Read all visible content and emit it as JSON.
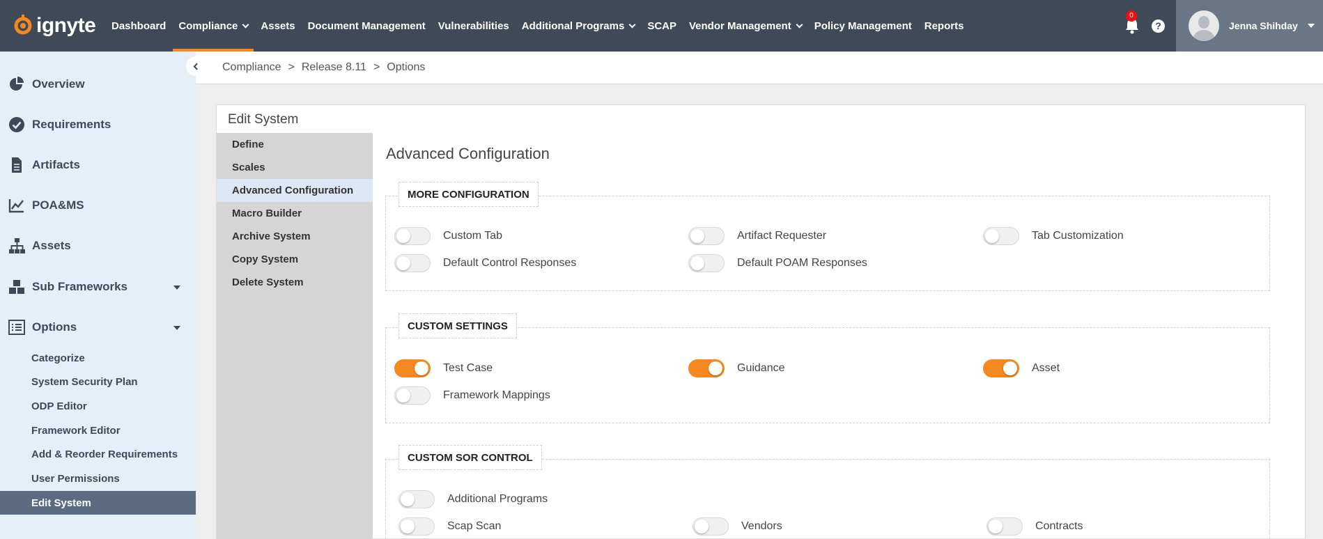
{
  "brand": {
    "name": "ignyte",
    "accent": "#f5891f"
  },
  "nav": {
    "items": [
      {
        "label": "Dashboard",
        "dropdown": false
      },
      {
        "label": "Compliance",
        "dropdown": true,
        "active": true
      },
      {
        "label": "Assets",
        "dropdown": false
      },
      {
        "label": "Document Management",
        "dropdown": false
      },
      {
        "label": "Vulnerabilities",
        "dropdown": false
      },
      {
        "label": "Additional Programs",
        "dropdown": true
      },
      {
        "label": "SCAP",
        "dropdown": false
      },
      {
        "label": "Vendor Management",
        "dropdown": true
      },
      {
        "label": "Policy Management",
        "dropdown": false
      },
      {
        "label": "Reports",
        "dropdown": false
      }
    ],
    "notification_count": "0",
    "help_label": "?",
    "user_name": "Jenna Shihday"
  },
  "sidebar": {
    "items": [
      {
        "label": "Overview",
        "icon": "pie-chart-icon"
      },
      {
        "label": "Requirements",
        "icon": "check-circle-icon"
      },
      {
        "label": "Artifacts",
        "icon": "document-icon"
      },
      {
        "label": "POA&MS",
        "icon": "line-chart-icon"
      },
      {
        "label": "Assets",
        "icon": "sitemap-icon"
      },
      {
        "label": "Sub Frameworks",
        "icon": "cubes-icon"
      },
      {
        "label": "Options",
        "icon": "list-icon"
      }
    ],
    "sub_items": [
      {
        "label": "Categorize"
      },
      {
        "label": "System Security Plan"
      },
      {
        "label": "ODP Editor"
      },
      {
        "label": "Framework Editor"
      },
      {
        "label": "Add & Reorder Requirements"
      },
      {
        "label": "User Permissions"
      },
      {
        "label": "Edit System",
        "active": true
      }
    ]
  },
  "breadcrumb": [
    "Compliance",
    "Release 8.11",
    "Options"
  ],
  "breadcrumb_separator": ">",
  "panel": {
    "title": "Edit System",
    "menu": [
      {
        "label": "Define"
      },
      {
        "label": "Scales"
      },
      {
        "label": "Advanced Configuration",
        "active": true
      },
      {
        "label": "Macro Builder"
      },
      {
        "label": "Archive System"
      },
      {
        "label": "Copy System"
      },
      {
        "label": "Delete System"
      }
    ],
    "content_title": "Advanced Configuration",
    "sections": [
      {
        "legend": "MORE CONFIGURATION",
        "toggles": [
          {
            "label": "Custom Tab",
            "on": false
          },
          {
            "label": "Artifact Requester",
            "on": false
          },
          {
            "label": "Tab Customization",
            "on": false
          },
          {
            "label": "Default Control Responses",
            "on": false
          },
          {
            "label": "Default POAM Responses",
            "on": false
          }
        ]
      },
      {
        "legend": "CUSTOM SETTINGS",
        "toggles": [
          {
            "label": "Test Case",
            "on": true
          },
          {
            "label": "Guidance",
            "on": true
          },
          {
            "label": "Asset",
            "on": true
          },
          {
            "label": "Framework Mappings",
            "on": false
          }
        ]
      },
      {
        "legend": "CUSTOM SOR CONTROL",
        "toggles": [
          {
            "label": "Additional Programs",
            "on": false
          },
          {
            "label": "Scap Scan",
            "on": false
          },
          {
            "label": "Vendors",
            "on": false
          },
          {
            "label": "Contracts",
            "on": false
          }
        ]
      }
    ]
  }
}
